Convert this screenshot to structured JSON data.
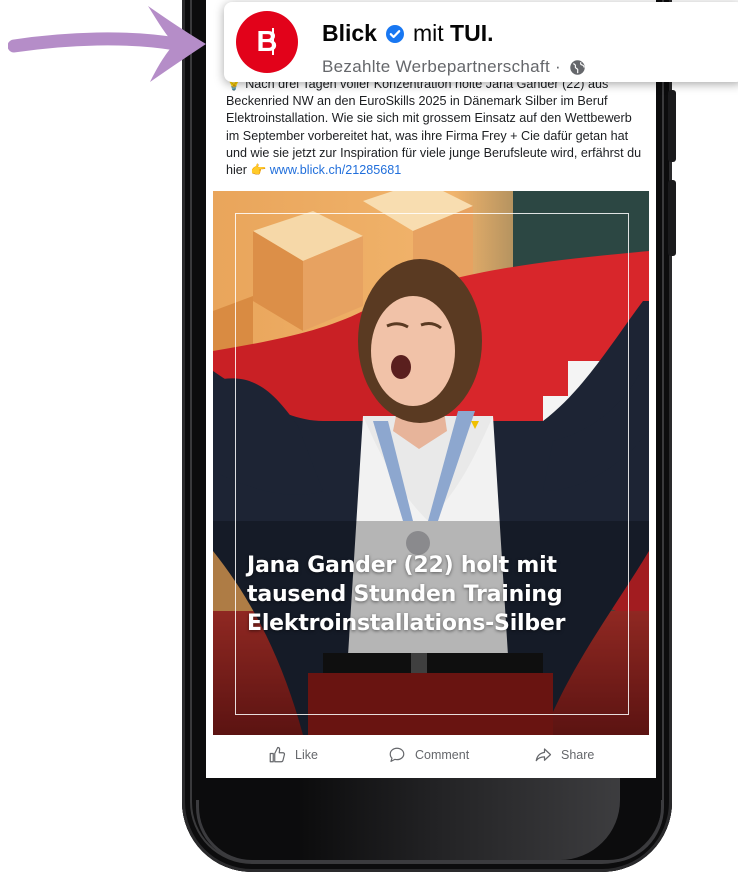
{
  "post": {
    "page_name": "Blick",
    "with_text": "mit",
    "partner_name": "TUI.",
    "sponsored_label": "Bezahlte Werbepartnerschaft ·",
    "logo_letter": "B",
    "text_first_line": "Nach drei Tagen voller Konzentration holte Jana Gander (22) aus",
    "text_body": "Beckenried NW an den EuroSkills 2025 in Dänemark Silber im Beruf Elektroinstallation. Wie sie sich mit grossem Einsatz auf den Wettbewerb im September vorbereitet hat, was ihre Firma Frey + Cie dafür getan hat und wie sie jetzt zur Inspiration für viele junge Berufsleute wird, erfährst du hier",
    "link": "www.blick.ch/21285681",
    "headline_line1": "Jana Gander (22) holt mit",
    "headline_line2": "tausend Stunden Training",
    "headline_line3": "Elektroinstallations-Silber"
  },
  "actions": {
    "like": "Like",
    "comment": "Comment",
    "share": "Share"
  },
  "icons": [
    "pointing-hand-emoji",
    "verified-badge-icon",
    "globe-icon",
    "thumbs-up-icon",
    "comment-icon",
    "share-icon",
    "pointer-arrow"
  ],
  "colors": {
    "brand_red": "#e2021a",
    "link_blue": "#216fdb",
    "verified_blue": "#1877f2",
    "arrow_purple": "#b58dc8",
    "muted_text": "#65676b"
  }
}
